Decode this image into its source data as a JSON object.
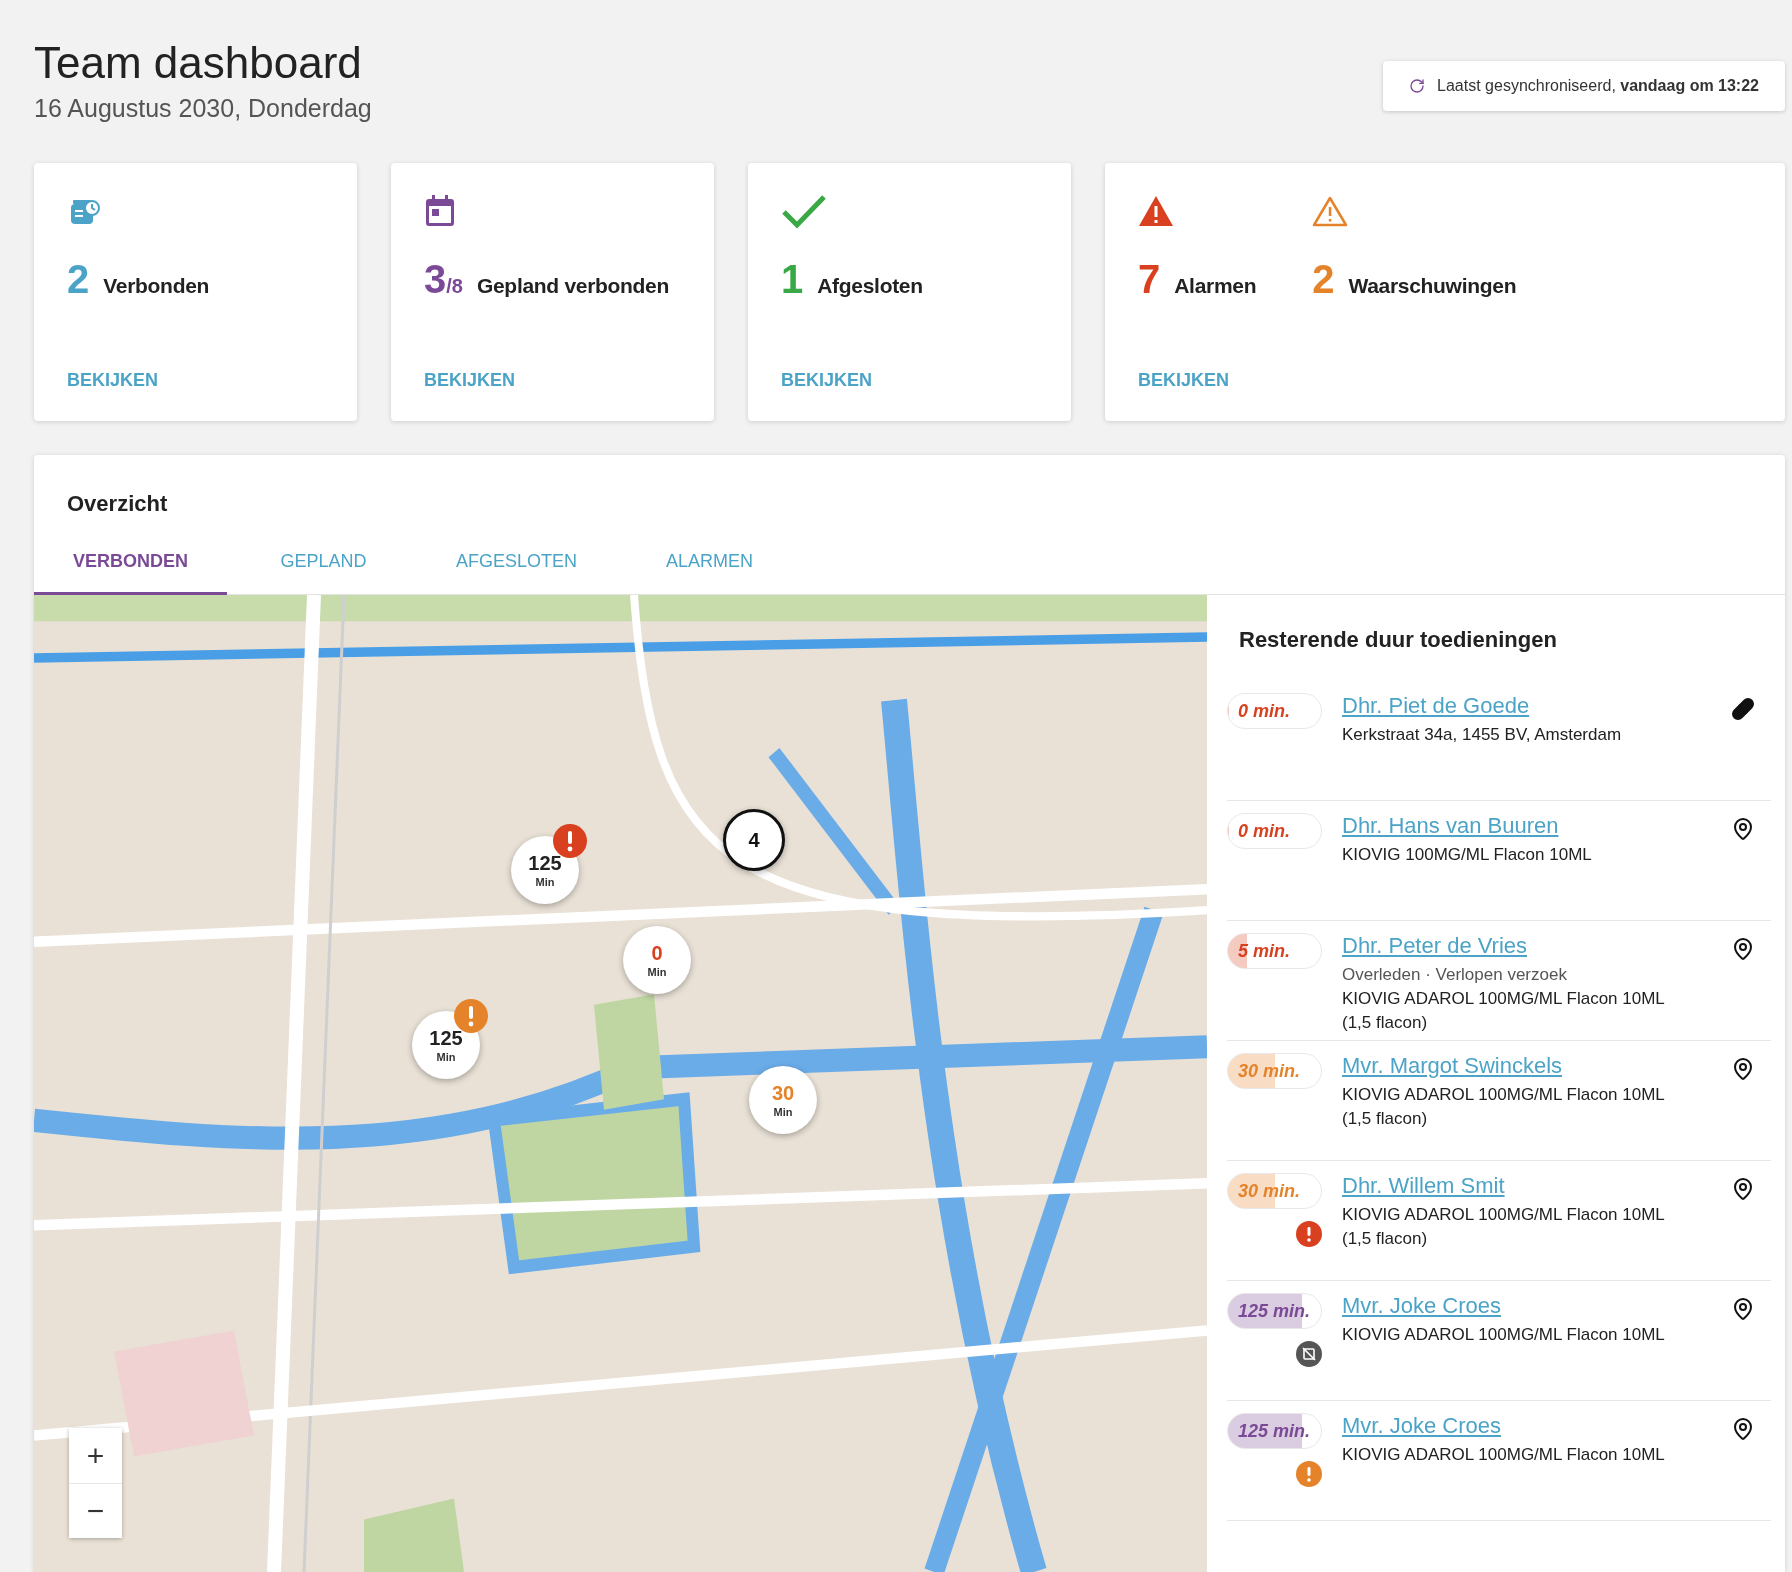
{
  "header": {
    "title": "Team dashboard",
    "date": "16 Augustus 2030, Donderdag",
    "sync": "Laatst gesynchroniseerd, **vandaag om 13:22**"
  },
  "cards": [
    {
      "stats": [
        {
          "kind": "connected",
          "value": "2",
          "color": "#4ba3c7",
          "label": "Verbonden"
        }
      ],
      "link": "BEKIJKEN"
    },
    {
      "stats": [
        {
          "kind": "planned",
          "value": "3",
          "suffix": "/8",
          "color": "#7b4a97",
          "label": "Gepland verbonden"
        }
      ],
      "link": "BEKIJKEN"
    },
    {
      "stats": [
        {
          "kind": "closed",
          "value": "1",
          "color": "#3aa845",
          "label": "Afgesloten"
        }
      ],
      "link": "BEKIJKEN"
    },
    {
      "stats": [
        {
          "kind": "alarm",
          "value": "7",
          "color": "#d9401f",
          "label": "Alarmen"
        },
        {
          "kind": "warning",
          "value": "2",
          "color": "#e5832b",
          "label": "Waarschuwingen"
        }
      ],
      "link": "BEKIJKEN"
    }
  ],
  "overview": {
    "title": "Overzicht",
    "tabs": [
      {
        "label": "VERBONDEN",
        "selected": true
      },
      {
        "label": "GEPLAND",
        "selected": false
      },
      {
        "label": "AFGESLOTEN",
        "selected": false
      },
      {
        "label": "ALARMEN",
        "selected": false
      }
    ],
    "map": {
      "markers": [
        {
          "kind": "cluster",
          "value": "4"
        },
        {
          "kind": "marker",
          "value": "125",
          "unit": "Min",
          "color": "#222222",
          "alarm": true,
          "warning": false
        },
        {
          "kind": "marker",
          "value": "0",
          "unit": "Min",
          "color": "#d9401f",
          "alarm": false,
          "warning": false
        },
        {
          "kind": "marker",
          "value": "125",
          "unit": "Min",
          "color": "#222222",
          "alarm": false,
          "warning": true
        },
        {
          "kind": "marker",
          "value": "30",
          "unit": "Min",
          "color": "#e5832b",
          "alarm": false,
          "warning": false
        }
      ],
      "zoom_in": "+",
      "zoom_out": "−"
    },
    "list": {
      "title": "Resterende duur toedieningen",
      "items": [
        {
          "time": "0 min.",
          "level": 0,
          "color": "#d9401f",
          "name": "Dhr. Piet de Goede",
          "lines": [
            "Kerkstraat 34a, 1455 BV, Amsterdam"
          ],
          "kind": "medication",
          "alarm": false,
          "offline": false,
          "warning": false
        },
        {
          "time": "0 min.",
          "level": 0,
          "color": "#d9401f",
          "name": "Dhr. Hans van Buuren",
          "lines": [
            "KIOVIG 100MG/ML Flacon 10ML"
          ],
          "kind": "location",
          "alarm": false,
          "offline": false,
          "warning": false
        },
        {
          "time": "5 min.",
          "level": 0.2,
          "color": "#d9401f",
          "name": "Dhr. Peter de Vries",
          "note": "Overleden · Verlopen verzoek",
          "lines": [
            "KIOVIG ADAROL 100MG/ML Flacon 10ML",
            "(1,5 flacon)"
          ],
          "kind": "location",
          "alarm": false,
          "offline": false,
          "warning": false
        },
        {
          "time": "30 min.",
          "level": 0.5,
          "color": "#e5832b",
          "name": "Mvr. Margot Swinckels",
          "lines": [
            "KIOVIG ADAROL 100MG/ML Flacon 10ML",
            "(1,5 flacon)"
          ],
          "kind": "location",
          "alarm": false,
          "offline": false,
          "warning": false
        },
        {
          "time": "30 min.",
          "level": 0.5,
          "color": "#e5832b",
          "name": "Dhr. Willem Smit",
          "lines": [
            "KIOVIG ADAROL 100MG/ML Flacon 10ML",
            "(1,5 flacon)"
          ],
          "kind": "location",
          "alarm": true,
          "offline": false,
          "warning": false
        },
        {
          "time": "125 min.",
          "level": 0.8,
          "color": "#7b4a97",
          "name": "Mvr. Joke Croes",
          "lines": [
            "KIOVIG ADAROL 100MG/ML Flacon 10ML"
          ],
          "kind": "location",
          "alarm": false,
          "offline": true,
          "warning": false
        },
        {
          "time": "125 min.",
          "level": 0.8,
          "color": "#7b4a97",
          "name": "Mvr. Joke Croes",
          "lines": [
            "KIOVIG ADAROL 100MG/ML Flacon 10ML"
          ],
          "kind": "location",
          "alarm": false,
          "offline": false,
          "warning": true
        }
      ]
    }
  }
}
